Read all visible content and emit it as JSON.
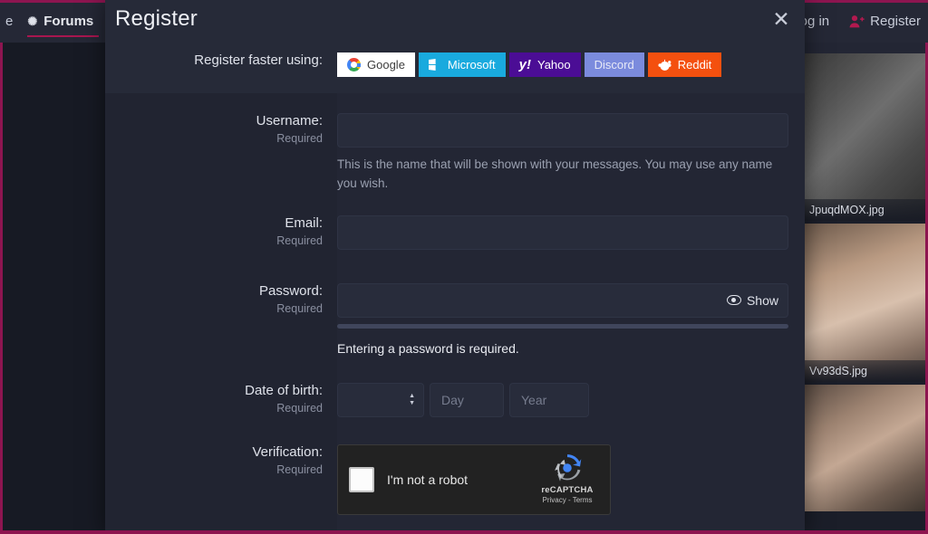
{
  "background": {
    "nav": {
      "item_partial": "e",
      "forums_label": "Forums",
      "forums_icon": "sun-icon",
      "login_label": "og in",
      "register_label": "Register",
      "register_icon": "user-add-icon"
    },
    "media_rail": {
      "items": [
        {
          "filename": "JpuqdMOX.jpg"
        },
        {
          "filename": "Vv93dS.jpg"
        },
        {
          "filename": ""
        }
      ]
    }
  },
  "modal": {
    "title": "Register",
    "close_icon": "close-icon",
    "social": {
      "label": "Register faster using:",
      "buttons": [
        {
          "name": "Google",
          "icon": "google-icon"
        },
        {
          "name": "Microsoft",
          "icon": "microsoft-icon"
        },
        {
          "name": "Yahoo",
          "icon": "yahoo-icon"
        },
        {
          "name": "Discord",
          "icon": "discord-icon"
        },
        {
          "name": "Reddit",
          "icon": "reddit-icon"
        }
      ]
    },
    "fields": {
      "username": {
        "label": "Username:",
        "required": "Required",
        "value": "",
        "placeholder": "",
        "hint": "This is the name that will be shown with your messages. You may use any name you wish."
      },
      "email": {
        "label": "Email:",
        "required": "Required",
        "value": "",
        "placeholder": ""
      },
      "password": {
        "label": "Password:",
        "required": "Required",
        "value": "",
        "placeholder": "",
        "show_label": "Show",
        "show_icon": "eye-icon",
        "error": "Entering a password is required."
      },
      "dob": {
        "label": "Date of birth:",
        "required": "Required",
        "month_value": "",
        "month_icon": "updown-arrows-icon",
        "day_placeholder": "Day",
        "day_value": "",
        "year_placeholder": "Year",
        "year_value": ""
      },
      "verification": {
        "label": "Verification:",
        "required": "Required",
        "captcha": {
          "checkbox_label": "I'm not a robot",
          "checked": false,
          "brand": "reCAPTCHA",
          "terms": "Privacy - Terms",
          "logo_icon": "recaptcha-icon"
        }
      }
    }
  },
  "colors": {
    "accent_magenta": "#8d1550",
    "modal_bg": "#262a38",
    "body_bg": "#232634",
    "label_col_bg": "#212431",
    "input_bg": "#282c3b",
    "google": "#ffffff",
    "microsoft": "#19aade",
    "yahoo": "#4b0d95",
    "discord": "#7b8bdd",
    "reddit": "#f4500f"
  }
}
